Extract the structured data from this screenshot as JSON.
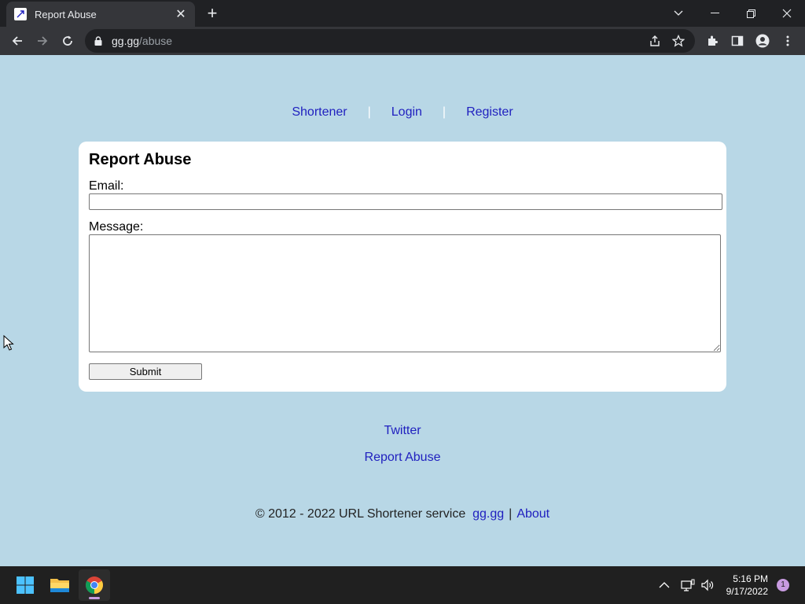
{
  "browser": {
    "tab_title": "Report Abuse",
    "url_host": "gg.gg",
    "url_path": "/abuse"
  },
  "nav": {
    "shortener": "Shortener",
    "sep": "|",
    "login": "Login",
    "register": "Register"
  },
  "form": {
    "title": "Report Abuse",
    "email_label": "Email:",
    "email_value": "",
    "message_label": "Message:",
    "message_value": "",
    "submit_label": "Submit"
  },
  "footer": {
    "twitter": "Twitter",
    "report_abuse": "Report Abuse",
    "copyright": "© 2012 - 2022 URL Shortener service",
    "site_link": "gg.gg",
    "bar": "|",
    "about": "About"
  },
  "taskbar": {
    "time": "5:16 PM",
    "date": "9/17/2022",
    "notifications": "1"
  },
  "colors": {
    "page_bg": "#b8d7e6",
    "link": "#1f1fbf"
  }
}
